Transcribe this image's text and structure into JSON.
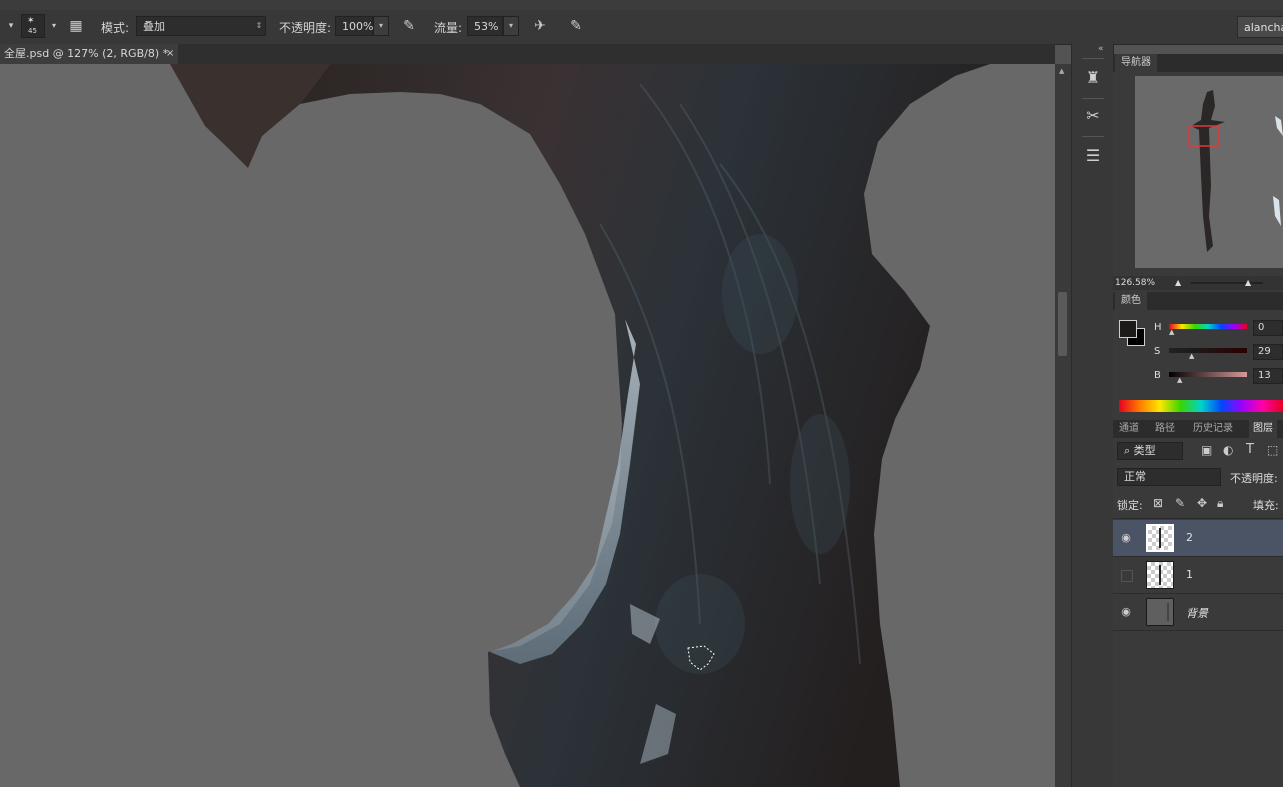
{
  "options_bar": {
    "brush_size": "45",
    "mode_label": "模式:",
    "mode_value": "叠加",
    "opacity_label": "不透明度:",
    "opacity_value": "100%",
    "flow_label": "流量:",
    "flow_value": "53%",
    "user_name": "alanchan"
  },
  "document": {
    "tab_title": "全屋.psd @ 127% (2, RGB/8) *",
    "close_glyph": "×"
  },
  "navigator": {
    "title": "导航器",
    "zoom": "126.58%"
  },
  "color_panel": {
    "title": "颜色",
    "h_label": "H",
    "h_value": "0",
    "s_label": "S",
    "s_value": "29",
    "b_label": "B",
    "b_value": "13",
    "foreground_color": "#1d1a1a",
    "background_color": "#000000"
  },
  "layers_panel": {
    "tabs": [
      "通道",
      "路径",
      "历史记录",
      "图层"
    ],
    "filter_kind": "类型",
    "blend_mode": "正常",
    "opacity_label": "不透明度:",
    "lock_label": "锁定:",
    "fill_label": "填充:",
    "layers": [
      {
        "name": "2",
        "visible": true,
        "selected": true
      },
      {
        "name": "1",
        "visible": false,
        "selected": false
      },
      {
        "name": "背景",
        "visible": true,
        "selected": false
      }
    ]
  },
  "colors": {
    "accent_selection": "#4b5465",
    "canvas_gray": "#686868"
  }
}
